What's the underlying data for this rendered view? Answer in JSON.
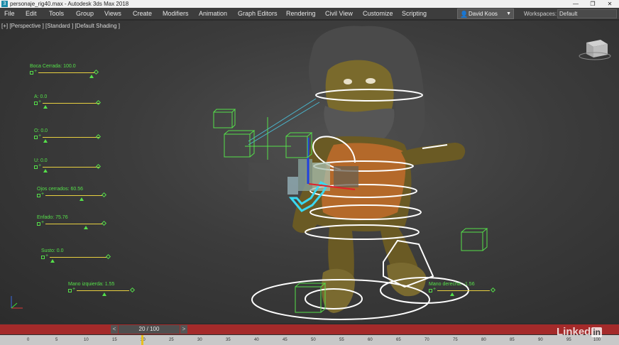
{
  "window": {
    "title": "personaje_rig40.max - Autodesk 3ds Max 2018",
    "app_icon": "3ds-max-icon"
  },
  "menus": [
    "File",
    "Edit",
    "Tools",
    "Group",
    "Views",
    "Create",
    "Modifiers",
    "Animation",
    "Graph Editors",
    "Rendering",
    "Civil View",
    "Customize",
    "Scripting"
  ],
  "user": {
    "name": "David Koos"
  },
  "workspace": {
    "label": "Workspaces:",
    "value": "Default"
  },
  "viewport": {
    "label": "[+] [Perspective ] [Standard ] [Default Shading ]"
  },
  "sliders": [
    {
      "label": "Boca Cerrada: 100.0",
      "value": 100.0
    },
    {
      "label": "A: 0.0",
      "value": 0.0
    },
    {
      "label": "O: 0.0",
      "value": 0.0
    },
    {
      "label": "U: 0.0",
      "value": 0.0
    },
    {
      "label": "Ojos cerrados: 60.56",
      "value": 60.56
    },
    {
      "label": "Enfado: 75.76",
      "value": 75.76
    },
    {
      "label": "Susto: 0.0",
      "value": 0.0
    },
    {
      "label": "Mano izquierda: 1.55",
      "value": 1.55
    },
    {
      "label": "Mano derecha: -1.56",
      "value": -1.56
    }
  ],
  "timeline": {
    "frame_display": "20 / 100",
    "prev": "<",
    "next": ">",
    "ticks": [
      "0",
      "5",
      "10",
      "15",
      "20",
      "25",
      "30",
      "35",
      "40",
      "45",
      "50",
      "55",
      "60",
      "65",
      "70",
      "75",
      "80",
      "85",
      "90",
      "95",
      "100"
    ]
  },
  "watermark": {
    "text": "Linked",
    "badge": "in"
  },
  "colors": {
    "control_green": "#55e04a",
    "slider_track": "#e8d040",
    "timeline_red": "#a42a2a"
  }
}
